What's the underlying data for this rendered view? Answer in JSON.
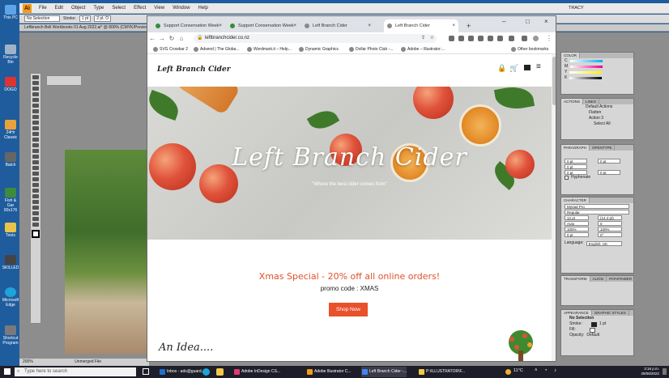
{
  "desktop": {
    "icons": [
      "This PC",
      "Recycle Bin",
      "DOGO",
      "24Hr Classic",
      "Batch",
      "Fish & Gar 90x176",
      "Tools",
      "SKILLED",
      "Microsoft Edge",
      "Shortcut Program"
    ]
  },
  "illustrator": {
    "logo": "Ai",
    "menu": [
      "File",
      "Edit",
      "Object",
      "Type",
      "Select",
      "Effect",
      "View",
      "Window",
      "Help"
    ],
    "user": "TRACY",
    "control": {
      "selection": "No Selection",
      "stroke_label": "Stroke:",
      "stroke_value": "1 pt",
      "brush": "2 pt. O"
    },
    "doc_tab": "Leftbranch Bell Workbooks 01 Aug 2022.ai* @ 800% (CMYK/Preview)",
    "status": {
      "zoom": "200%",
      "doc": "Unmerged File"
    },
    "panels": {
      "color": {
        "tabs": [
          "COLOR"
        ],
        "rows": [
          "C",
          "M",
          "Y",
          "K"
        ]
      },
      "actions": {
        "tabs": [
          "ACTIONS",
          "LINKS"
        ],
        "items": [
          "Default Actions",
          "Flatten",
          "Action 3",
          "Select All"
        ]
      },
      "paragraph": {
        "tabs": [
          "PARAGRAPH",
          "OPENTYPE"
        ],
        "values": [
          "0 pt",
          "0 pt",
          "0 pt",
          "0 pt",
          "0 pt"
        ],
        "hyphenate": "Hyphenate"
      },
      "character": {
        "tabs": [
          "CHARACTER"
        ],
        "font": "Myriad Pro",
        "style": "Regular",
        "size": "12 pt",
        "leading": "(14.4 pt)",
        "kerning": "Auto",
        "tracking": "0",
        "scale_v": "100%",
        "scale_h": "100%",
        "baseline": "0 pt",
        "rotation": "0°",
        "language_label": "Language:",
        "language": "English: UK"
      },
      "transform": {
        "tabs": [
          "TRANSFORM",
          "ALIGN",
          "PATHFINDER"
        ]
      },
      "appearance": {
        "tabs": [
          "APPEARANCE",
          "GRAPHIC STYLES"
        ],
        "title": "No Selection",
        "stroke": "Stroke:",
        "stroke_val": "1 pt",
        "fill": "Fill:",
        "opacity": "Opacity:",
        "opacity_val": "Default"
      }
    }
  },
  "browser": {
    "tabs": [
      {
        "title": "Support Conservation Week"
      },
      {
        "title": "Support Conservation Week"
      },
      {
        "title": "Left Branch Cider"
      },
      {
        "title": "Left Branch Cider"
      }
    ],
    "new_tab": "+",
    "url": "leftbranchcider.co.nz",
    "bookmarks": [
      "SVG Crowbar 2",
      "Adsend | The Globa...",
      "Wordmark.it – Help...",
      "Dynamic Graphics",
      "Dollar Photo Club -...",
      "Adobe – Illustrator:..."
    ],
    "other_bookmarks": "Other bookmarks"
  },
  "site": {
    "logo": "Left Branch Cider",
    "hero_title": "Left Branch Cider",
    "hero_sub": "\"Where the best cider comes from\"",
    "promo": "Xmas Special - 20% off all online orders!",
    "promo_code": "promo code : XMAS",
    "shop_button": "Shop Now",
    "section_heading": "An Idea...."
  },
  "taskbar": {
    "search": "Type here to search",
    "apps": [
      {
        "label": "Inbox - ads@guard...",
        "color": "#1e6fd0"
      },
      {
        "label": "Adobe InDesign CS...",
        "color": "#e03a74"
      },
      {
        "label": "Adobe Illustrator C...",
        "color": "#f49b1d"
      },
      {
        "label": "Left Branch Cider -...",
        "color": "#4285f4"
      },
      {
        "label": "P:\\ILLUSTRATOR\\F...",
        "color": "#f2c94c"
      }
    ],
    "temp": "11°C",
    "time": "3:16 p.m.",
    "date": "29/08/2022"
  }
}
